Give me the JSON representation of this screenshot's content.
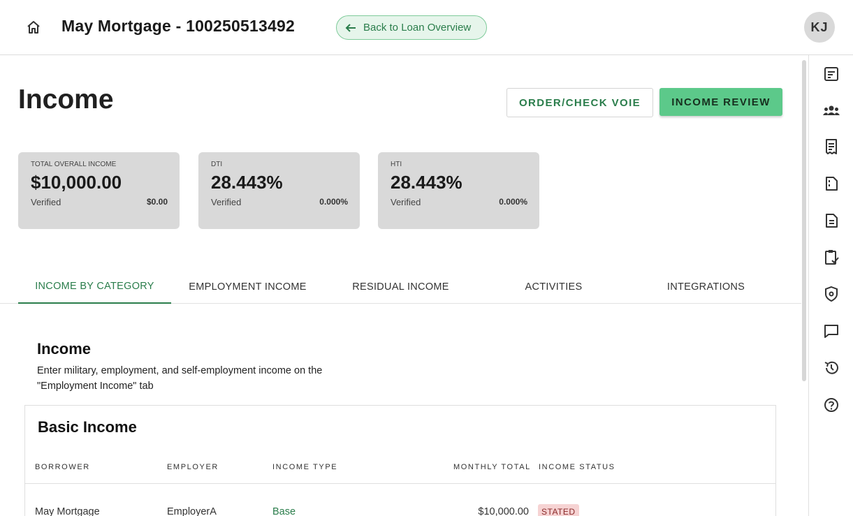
{
  "header": {
    "loan_title": "May Mortgage - 100250513492",
    "back_label": "Back to Loan Overview",
    "avatar_initials": "KJ"
  },
  "page": {
    "title": "Income",
    "order_voie_label": "ORDER/CHECK VOIE",
    "income_review_label": "INCOME REVIEW"
  },
  "summary_cards": [
    {
      "label": "TOTAL OVERALL INCOME",
      "value": "$10,000.00",
      "verified_label": "Verified",
      "verified_value": "$0.00"
    },
    {
      "label": "DTI",
      "value": "28.443%",
      "verified_label": "Verified",
      "verified_value": "0.000%"
    },
    {
      "label": "HTI",
      "value": "28.443%",
      "verified_label": "Verified",
      "verified_value": "0.000%"
    }
  ],
  "tabs": [
    {
      "label": "INCOME BY CATEGORY",
      "active": true
    },
    {
      "label": "EMPLOYMENT INCOME",
      "active": false
    },
    {
      "label": "RESIDUAL INCOME",
      "active": false
    },
    {
      "label": "ACTIVITIES",
      "active": false
    },
    {
      "label": "INTEGRATIONS",
      "active": false
    }
  ],
  "section": {
    "title": "Income",
    "description": "Enter military, employment, and self-employment income on the \"Employment Income\" tab"
  },
  "basic_income": {
    "title": "Basic Income",
    "columns": [
      "BORROWER",
      "EMPLOYER",
      "INCOME TYPE",
      "MONTHLY TOTAL",
      "INCOME STATUS"
    ],
    "rows": [
      {
        "borrower": "May Mortgage",
        "employer": "EmployerA",
        "income_type": "Base",
        "monthly_total": "$10,000.00",
        "income_status": "STATED"
      }
    ]
  },
  "rail_icons": [
    "summary-icon",
    "borrowers-icon",
    "receipt-icon",
    "document-icon",
    "file-text-icon",
    "clipboard-check-icon",
    "shield-icon",
    "chat-icon",
    "history-icon",
    "help-icon"
  ],
  "colors": {
    "accent": "#2a7d4b",
    "primary_button": "#5cc98a",
    "card_bg": "#d9d9d9",
    "status_bg": "#f6d3d3"
  }
}
